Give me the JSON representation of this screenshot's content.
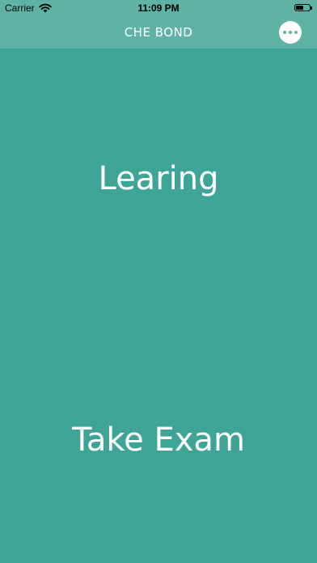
{
  "status_bar": {
    "carrier": "Carrier",
    "time": "11:09 PM",
    "battery_level": 0.55
  },
  "nav": {
    "title": "CHE BOND",
    "more_icon": "more-horizontal-icon"
  },
  "main": {
    "learning_label": "Learing",
    "exam_label": "Take Exam"
  },
  "colors": {
    "background": "#3ea596",
    "bar": "#5eb3a6",
    "text": "#ffffff"
  }
}
